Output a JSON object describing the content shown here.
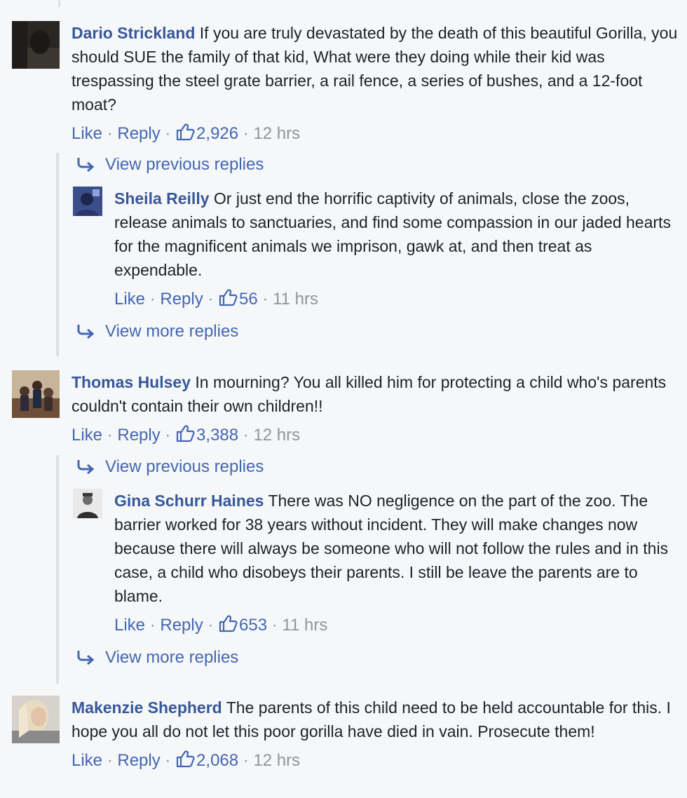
{
  "comments": [
    {
      "author": "Dario Strickland",
      "text": "If you are truly devastated by the death of this beautiful Gorilla, you should SUE the family of that kid, What were they doing while their kid was trespassing the steel grate barrier, a rail fence, a series of bushes, and a 12-foot moat?",
      "like_label": "Like",
      "reply_label": "Reply",
      "like_count": "2,926",
      "time": "12 hrs",
      "view_previous": "View previous replies",
      "view_more": "View more replies",
      "reply": {
        "author": "Sheila Reilly",
        "text": "Or just end the horrific captivity of animals, close the zoos, release animals to sanctuaries, and find some compassion in our jaded hearts for the magnificent animals we imprison, gawk at, and then treat as expendable.",
        "like_label": "Like",
        "reply_label": "Reply",
        "like_count": "56",
        "time": "11 hrs"
      }
    },
    {
      "author": "Thomas Hulsey",
      "text": "In mourning? You all killed him for protecting a child who's parents couldn't contain their own children!!",
      "like_label": "Like",
      "reply_label": "Reply",
      "like_count": "3,388",
      "time": "12 hrs",
      "view_previous": "View previous replies",
      "view_more": "View more replies",
      "reply": {
        "author": "Gina Schurr Haines",
        "text": "There was NO negligence on the part of the zoo. The barrier worked for 38 years without incident. They will make changes now because there will always be someone who will not follow the rules and in this case, a child who disobeys their parents. I still be leave the parents are to blame.",
        "like_label": "Like",
        "reply_label": "Reply",
        "like_count": "653",
        "time": "11 hrs"
      }
    },
    {
      "author": "Makenzie Shepherd",
      "text": "The parents of this child need to be held accountable for this. I hope you all do not let this poor gorilla have died in vain. Prosecute them!",
      "like_label": "Like",
      "reply_label": "Reply",
      "like_count": "2,068",
      "time": "12 hrs"
    }
  ],
  "separator": " · ",
  "colors": {
    "link": "#4267b2",
    "author": "#365899",
    "meta": "#90949c",
    "background": "#f6f7f9",
    "thread_rule": "#dddfe2"
  }
}
